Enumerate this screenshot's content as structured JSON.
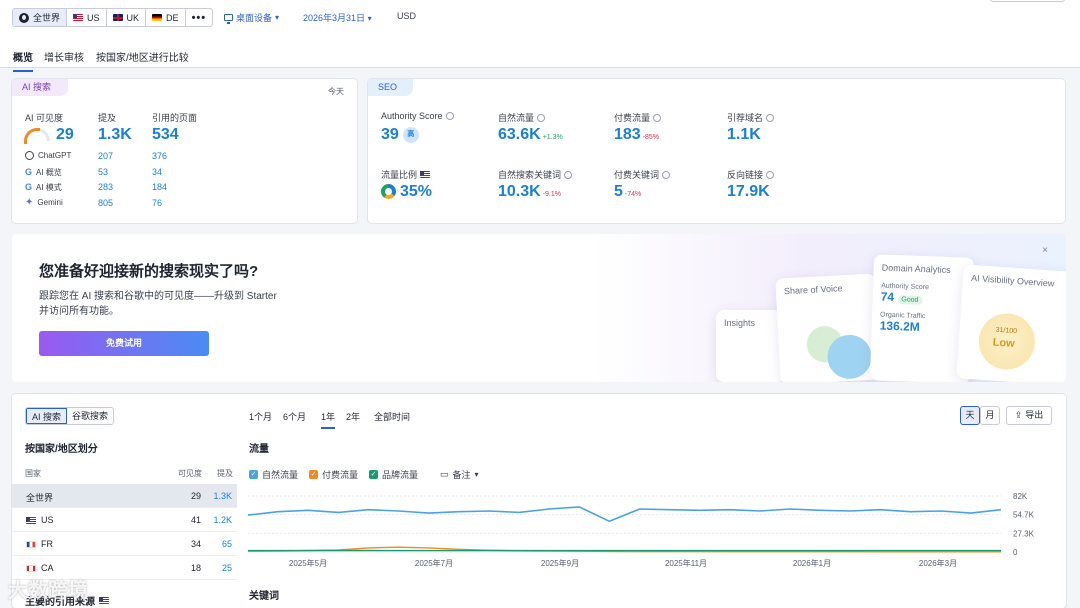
{
  "topbar": {
    "regions": [
      {
        "label": "全世界",
        "icon": "globe-icon"
      },
      {
        "label": "US",
        "icon": "flag-us-icon"
      },
      {
        "label": "UK",
        "icon": "flag-uk-icon"
      },
      {
        "label": "DE",
        "icon": "flag-de-icon"
      }
    ],
    "more_label": "•••",
    "device_label": "桌面设备",
    "date_label": "2026年3月31日",
    "currency_label": "USD"
  },
  "tabs": [
    "概览",
    "增长审核",
    "按国家/地区进行比较"
  ],
  "ai_card": {
    "tag": "AI 搜索",
    "today": "今天",
    "col_visibility": "AI 可见度",
    "col_mentions": "提及",
    "col_pages": "引用的页面",
    "visibility_value": "29",
    "visibility_level": 0.29,
    "mentions_value": "1.3K",
    "pages_value": "534",
    "rows": [
      {
        "name": "ChatGPT",
        "icon": "chatgpt-icon",
        "mentions": "207",
        "pages": "376"
      },
      {
        "name": "AI 概览",
        "icon": "google-icon",
        "mentions": "53",
        "pages": "34"
      },
      {
        "name": "AI 模式",
        "icon": "google-icon",
        "mentions": "283",
        "pages": "184"
      },
      {
        "name": "Gemini",
        "icon": "gemini-icon",
        "mentions": "805",
        "pages": "76"
      }
    ]
  },
  "seo_card": {
    "tag": "SEO",
    "authority_label": "Authority Score",
    "authority_value": "39",
    "authority_badge": "高",
    "organic_label": "自然流量",
    "organic_value": "63.6K",
    "organic_delta": "+1.3%",
    "paid_label": "付费流量",
    "paid_value": "183",
    "paid_delta": "-85%",
    "refdomains_label": "引荐域名",
    "refdomains_value": "1.1K",
    "share_label": "流量比例",
    "share_value": "35%",
    "organic_kw_label": "自然搜索关键词",
    "organic_kw_value": "10.3K",
    "organic_kw_delta": "-9.1%",
    "paid_kw_label": "付费关键词",
    "paid_kw_value": "5",
    "paid_kw_delta": "-74%",
    "backlinks_label": "反向链接",
    "backlinks_value": "17.9K"
  },
  "promo": {
    "title": "您准备好迎接新的搜索现实了吗?",
    "text_line1": "跟踪您在 AI 搜索和谷歌中的可见度——升级到 Starter",
    "text_line2": "并访问所有功能。",
    "button": "免费试用",
    "close": "×",
    "mock_insights": "Insights",
    "mock_share": "Share of Voice",
    "mock_domain": "Domain Analytics",
    "mock_as_label": "Authority Score",
    "mock_as_value": "74",
    "mock_as_badge": "Good",
    "mock_ot_label": "Organic Traffic",
    "mock_ot_value": "136.2M",
    "mock_vis": "AI Visibility Overview",
    "mock_vis_score": "31/100",
    "mock_vis_level": "Low"
  },
  "bottom": {
    "toggle": [
      "AI 搜索",
      "谷歌搜索"
    ],
    "country_title": "按国家/地区划分",
    "head_country": "国家",
    "head_visibility": "可见度",
    "head_mentions": "提及",
    "countries": [
      {
        "name": "全世界",
        "flag": "none",
        "visibility": "29",
        "mentions": "1.3K"
      },
      {
        "name": "US",
        "flag": "us",
        "visibility": "41",
        "mentions": "1.2K"
      },
      {
        "name": "FR",
        "flag": "fr",
        "visibility": "34",
        "mentions": "65"
      },
      {
        "name": "CA",
        "flag": "ca",
        "visibility": "18",
        "mentions": "25"
      }
    ],
    "sources_title": "主要的引用来源",
    "ranges": [
      "1个月",
      "6个月",
      "1年",
      "2年",
      "全部时间"
    ],
    "active_range": "1年",
    "traffic_title": "流量",
    "keywords_title": "关键词",
    "btn_day": "天",
    "btn_month": "月",
    "btn_export": "导出",
    "legend": [
      {
        "label": "自然流量",
        "color": "#4aa3df"
      },
      {
        "label": "付费流量",
        "color": "#f08a24"
      },
      {
        "label": "品牌流量",
        "color": "#1a9a6e"
      }
    ],
    "notes_label": "备注"
  },
  "chart_data": {
    "type": "line",
    "title": "流量",
    "x_ticks": [
      "2025年5月",
      "2025年7月",
      "2025年9月",
      "2025年11月",
      "2026年1月",
      "2026年3月"
    ],
    "y_ticks": [
      "0",
      "27.3K",
      "54.7K",
      "82K"
    ],
    "ylim": [
      0,
      82000
    ],
    "series": [
      {
        "name": "自然流量",
        "color": "#4aa3df",
        "values": [
          54000,
          59000,
          61000,
          58000,
          62000,
          60000,
          57000,
          59000,
          60000,
          58000,
          63000,
          66000,
          45000,
          63000,
          62000,
          61000,
          62000,
          60000,
          63000,
          61000,
          60000,
          62000,
          59000,
          60000,
          57000,
          62000
        ]
      },
      {
        "name": "付费流量",
        "color": "#f08a24",
        "values": [
          1200,
          1500,
          2200,
          3000,
          6000,
          7000,
          6000,
          4000,
          2500,
          1800,
          1500,
          1200,
          900,
          800,
          700,
          600,
          500,
          500,
          400,
          400,
          400,
          300,
          300,
          300,
          300,
          300
        ]
      },
      {
        "name": "品牌流量",
        "color": "#1a9a6e",
        "values": [
          2000,
          2100,
          2100,
          2000,
          2200,
          2100,
          2000,
          2100,
          2200,
          2100,
          2000,
          2100,
          2000,
          2100,
          2000,
          2100,
          2000,
          2000,
          2100,
          2000,
          2000,
          2100,
          2000,
          2000,
          2100,
          2000
        ]
      }
    ],
    "grid": true
  },
  "watermark": "大数跨境"
}
